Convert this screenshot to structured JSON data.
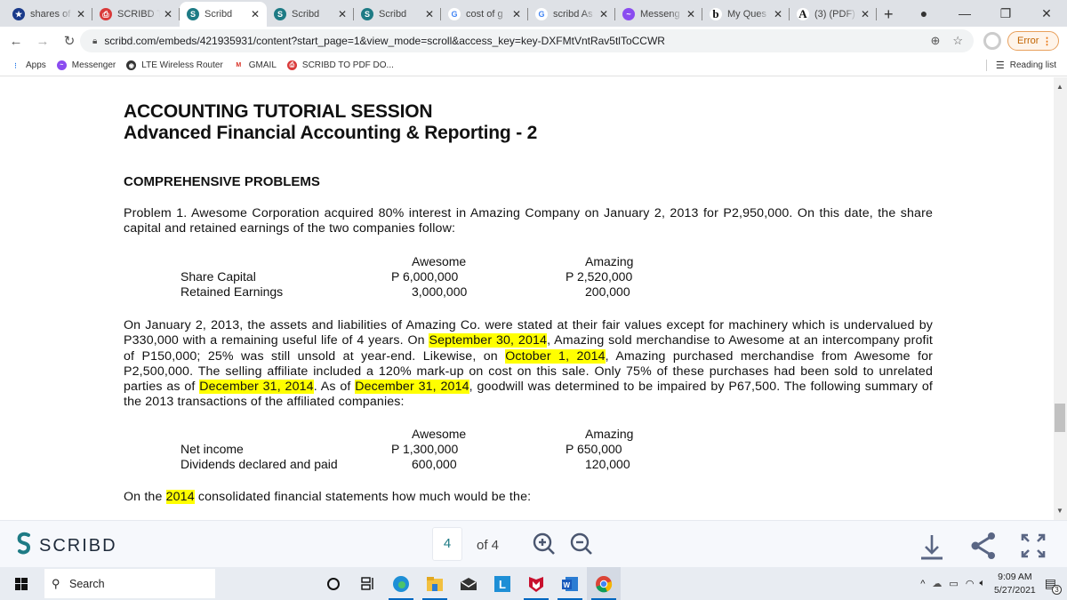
{
  "browser": {
    "tabs": [
      {
        "label": "shares of",
        "icon": "shield-star-icon",
        "active": false
      },
      {
        "label": "SCRIBD T",
        "icon": "scribd-pdf-icon",
        "active": false
      },
      {
        "label": "Scribd",
        "icon": "scribd-icon",
        "active": true
      },
      {
        "label": "Scribd",
        "icon": "scribd-icon",
        "active": false
      },
      {
        "label": "Scribd",
        "icon": "scribd-icon",
        "active": false
      },
      {
        "label": "cost of g",
        "icon": "google-icon",
        "active": false
      },
      {
        "label": "scribd As",
        "icon": "google-icon",
        "active": false
      },
      {
        "label": "Messeng",
        "icon": "messenger-icon",
        "active": false
      },
      {
        "label": "My Ques",
        "icon": "bartleby-icon",
        "active": false
      },
      {
        "label": "(3) (PDF)",
        "icon": "academia-icon",
        "active": false
      }
    ],
    "new_tab": "+",
    "url": "scribd.com/embeds/421935931/content?start_page=1&view_mode=scroll&access_key=key-DXFMtVntRav5tlToCCWR",
    "error_label": "Error",
    "bookmarks": [
      {
        "label": "Apps",
        "icon": "apps-grid-icon"
      },
      {
        "label": "Messenger",
        "icon": "messenger-icon"
      },
      {
        "label": "LTE Wireless Router",
        "icon": "globe-icon"
      },
      {
        "label": "GMAIL",
        "icon": "gmail-icon"
      },
      {
        "label": "SCRIBD TO PDF DO...",
        "icon": "scribd-pdf-icon"
      }
    ],
    "reading_list": "Reading list"
  },
  "document": {
    "title1": "ACCOUNTING TUTORIAL SESSION",
    "title2": "Advanced Financial Accounting & Reporting - 2",
    "section": "COMPREHENSIVE PROBLEMS",
    "p1": "Problem 1. Awesome Corporation acquired 80% interest in Amazing Company on January 2, 2013 for P2,950,000. On this date, the share capital and retained earnings of the two companies follow:",
    "table1": {
      "headers": [
        "",
        "Awesome",
        "Amazing"
      ],
      "rows": [
        {
          "label": "Share Capital",
          "awesome": "P  6,000,000",
          "amazing": "P  2,520,000"
        },
        {
          "label": "Retained Earnings",
          "awesome": "3,000,000",
          "amazing": "200,000"
        }
      ]
    },
    "p2": {
      "s1": "On January 2, 2013, the assets and liabilities of Amazing Co. were stated at their fair values except for machinery which is undervalued by P330,000 with a remaining useful life of 4 years. On ",
      "h1": "September 30, 2014",
      "s2": ", Amazing sold merchandise to Awesome at an intercompany profit of P150,000; 25% was still unsold at year-end. Likewise, on ",
      "h2": "October 1, 2014",
      "s3": ", Amazing purchased merchandise from Awesome for P2,500,000. The selling affiliate included a 120% mark-up on cost on this sale. Only 75% of these purchases had been sold to unrelated parties as of ",
      "h3": "December 31, 2014",
      "s4": ". As of ",
      "h4": "December 31, 2014",
      "s5": ", goodwill was determined to be impaired by P67,500. The following summary of the 2013 transactions of the affiliated companies:"
    },
    "table2": {
      "headers": [
        "",
        "Awesome",
        "Amazing"
      ],
      "rows": [
        {
          "label": "Net income",
          "awesome": "P  1,300,000",
          "amazing": "P  650,000"
        },
        {
          "label": "Dividends declared and paid",
          "awesome": "600,000",
          "amazing": "120,000"
        }
      ]
    },
    "p3": {
      "s1": "On the ",
      "h1": "2014",
      "s2": " consolidated financial statements how much would be the:"
    }
  },
  "viewer": {
    "brand": "SCRIBD",
    "page_current": "4",
    "page_total_label": "of 4"
  },
  "taskbar": {
    "search_placeholder": "Search",
    "time": "9:09 AM",
    "date": "5/27/2021",
    "notifications": "3"
  }
}
